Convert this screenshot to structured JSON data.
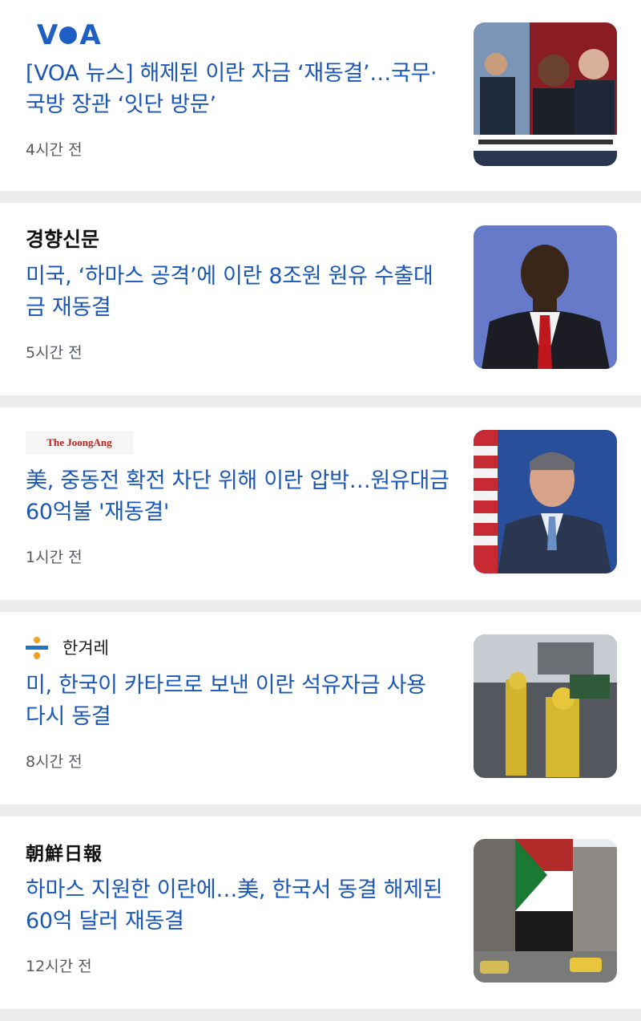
{
  "articles": [
    {
      "source": "VOA",
      "headline": "[VOA 뉴스] 해제된 이란 자금 ‘재동결’…국무·국방 장관 ‘잇단 방문’",
      "time": "4시간 전"
    },
    {
      "source": "경향신문",
      "headline": "미국, ‘하마스 공격’에 이란 8조원 원유 수출대금 재동결",
      "time": "5시간 전"
    },
    {
      "source": "The JoongAng",
      "headline": "美, 중동전 확전 차단 위해 이란 압박…원유대금 60억불 '재동결'",
      "time": "1시간 전"
    },
    {
      "source": "한겨레",
      "headline": "미, 한국이 카타르로 보낸 이란 석유자금 사용 다시 동결",
      "time": "8시간 전"
    },
    {
      "source": "朝鮮日報",
      "headline": "하마스 지원한 이란에…美, 한국서 동결 해제된 60억 달러 재동결",
      "time": "12시간 전"
    }
  ],
  "colors": {
    "headline": "#1a57b7",
    "time": "#555a60",
    "separator": "#ececee"
  }
}
